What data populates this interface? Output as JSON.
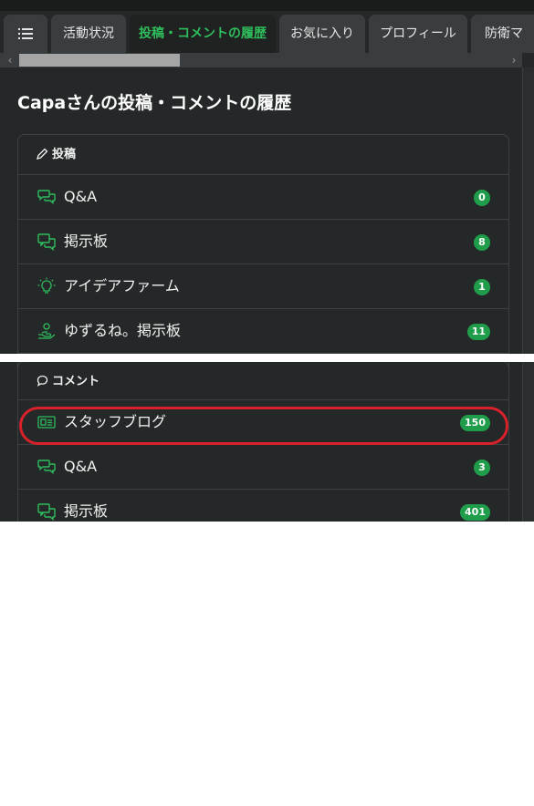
{
  "tabs": {
    "menu_icon": "list-icon",
    "items": [
      {
        "label": "活動状況"
      },
      {
        "label": "投稿・コメントの履歴"
      },
      {
        "label": "お気に入り"
      },
      {
        "label": "プロフィール"
      },
      {
        "label": "防衛マ"
      }
    ],
    "scroll_left": "‹",
    "scroll_right": "›"
  },
  "page": {
    "title": "Capaさんの投稿・コメントの履歴"
  },
  "posts": {
    "heading": "投稿",
    "icon": "pencil-icon",
    "items": [
      {
        "label": "Q&A",
        "count": "0",
        "icon": "chat-bubbles-icon"
      },
      {
        "label": "掲示板",
        "count": "8",
        "icon": "message-board-icon"
      },
      {
        "label": "アイデアファーム",
        "count": "1",
        "icon": "lightbulb-icon"
      },
      {
        "label": "ゆずるね。掲示板",
        "count": "11",
        "icon": "hand-share-icon"
      }
    ]
  },
  "comments": {
    "heading": "コメント",
    "icon": "speech-bubble-icon",
    "items": [
      {
        "label": "スタッフブログ",
        "count": "150",
        "icon": "blog-icon"
      },
      {
        "label": "Q&A",
        "count": "3",
        "icon": "chat-bubbles-icon"
      },
      {
        "label": "掲示板",
        "count": "401",
        "icon": "message-board-icon"
      }
    ]
  },
  "colors": {
    "accent": "#2fbd5c",
    "badge": "#1f9d4a",
    "highlight": "#d9212b",
    "background": "#252828"
  }
}
